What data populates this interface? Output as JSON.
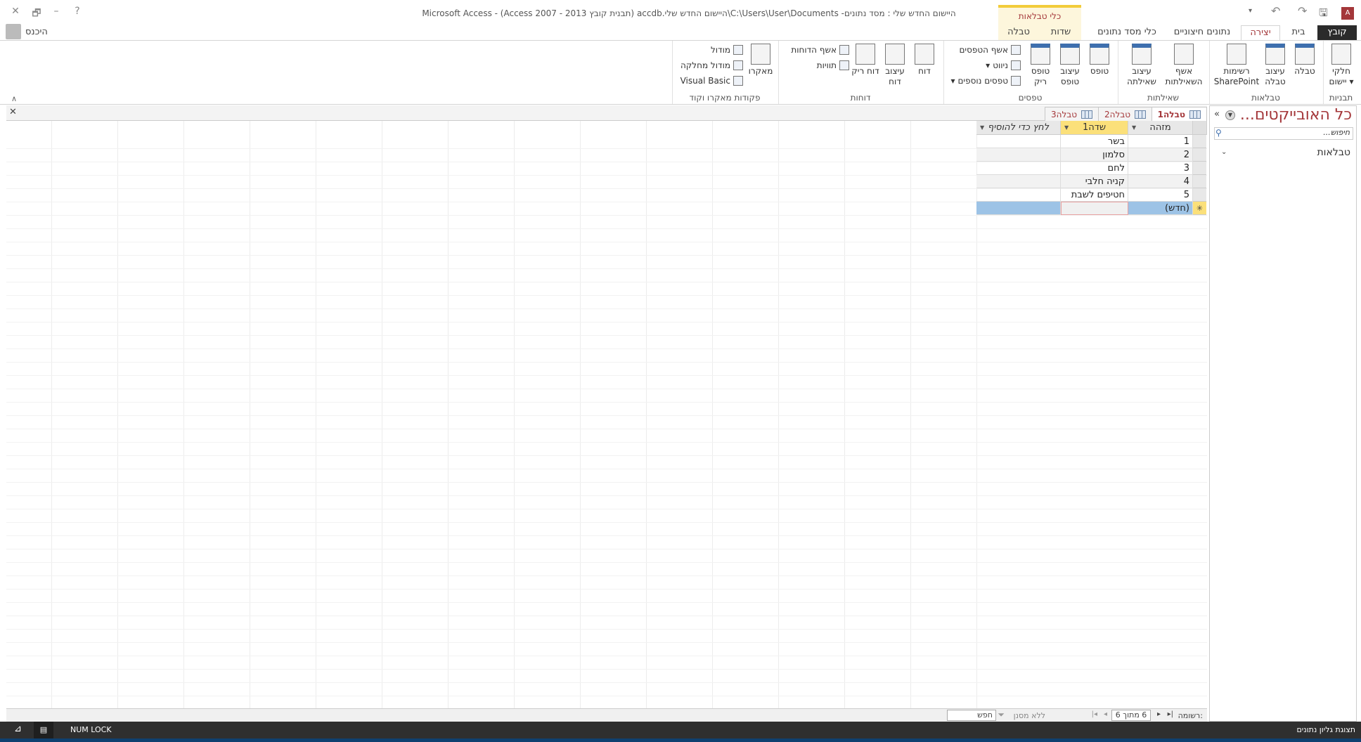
{
  "window": {
    "title": "היישום החדש שלי : מסד נתונים- C:\\Users\\User\\Documents\\היישום החדש שלי.accdb (תבנית קובץ Access 2007 - 2013) - Microsoft Access",
    "help": "?",
    "minimize": "–",
    "restore": "🗗",
    "close": "✕",
    "signin": "היכנס"
  },
  "ribbon": {
    "context_header": "כלי טבלאות",
    "tabs": [
      "קובץ",
      "בית",
      "יצירה",
      "נתונים חיצוניים",
      "כלי מסד נתונים",
      "שדות",
      "טבלה"
    ],
    "active_tab": "יצירה",
    "groups": {
      "templates": {
        "label": "תבניות",
        "app_parts": "חלקי יישום"
      },
      "tables": {
        "label": "טבלאות",
        "table": "טבלה",
        "table_design": "עיצוב טבלה",
        "sharepoint": "רשימות SharePoint"
      },
      "queries": {
        "label": "שאילתות",
        "wizard": "אשף השאילתות",
        "design": "עיצוב שאילתה"
      },
      "forms": {
        "label": "טפסים",
        "form": "טופס",
        "form_design": "עיצוב טופס",
        "blank_form": "טופס ריק",
        "form_wizard": "אשף הטפסים",
        "navigation": "ניווט",
        "more_forms": "טפסים נוספים"
      },
      "reports": {
        "label": "דוחות",
        "report": "דוח",
        "report_design": "עיצוב דוח",
        "blank_report": "דוח ריק",
        "report_wizard": "אשף הדוחות",
        "labels": "תוויות"
      },
      "macros": {
        "label": "פקודות מאקרו וקוד",
        "macro": "מאקרו",
        "module": "מודול",
        "class_module": "מודול מחלקה",
        "vb": "Visual Basic"
      }
    }
  },
  "nav": {
    "title": "כל האובייקטים...",
    "search_placeholder": "חיפוש...",
    "section": "טבלאות"
  },
  "doc_tabs": [
    "טבלה1",
    "טבלה2",
    "טבלה3"
  ],
  "datasheet": {
    "columns": [
      "מזהה",
      "שדה1",
      "לחץ כדי להוסיף"
    ],
    "rows": [
      [
        "1",
        "בשר"
      ],
      [
        "2",
        "סלמון"
      ],
      [
        "3",
        "לחם"
      ],
      [
        "4",
        "קניה חלבי"
      ],
      [
        "5",
        "חטיפים לשבת"
      ]
    ],
    "new_row": "(חדש)"
  },
  "record_nav": {
    "label": "רשומה:",
    "position": "6 מתוך 6",
    "filter": "ללא מסנן",
    "search": "חפש"
  },
  "status": {
    "view": "תצוגת גליון נתונים",
    "numlock": "NUM LOCK"
  }
}
